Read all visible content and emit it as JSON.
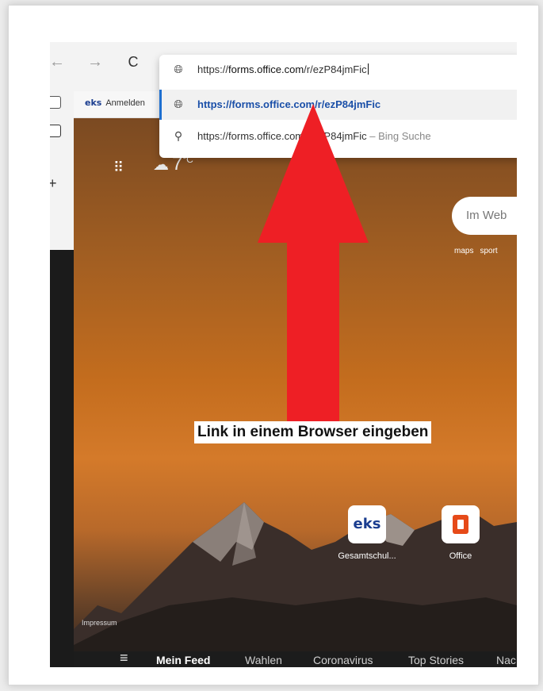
{
  "browser": {
    "nav": {
      "back_icon": "←",
      "forward_icon": "→",
      "reload_icon": "C"
    },
    "address_bar": {
      "input_prefix": "https://",
      "input_host": "forms.office.com",
      "input_path": "/r/ezP84jmFic",
      "suggestion_1": "https://forms.office.com/r/ezP84jmFic",
      "suggestion_2": "https://forms.office.com/r/ezP84jmFic",
      "suggestion_2_suffix": " – Bing Suche"
    },
    "favorites": {
      "item_logo": "eks",
      "item_label": "Anmelden"
    }
  },
  "newtab": {
    "weather": {
      "temp": "7",
      "unit": "°C"
    },
    "search_placeholder": "Im Web",
    "quick_links": [
      "maps",
      "sport"
    ],
    "tiles": [
      {
        "label": "Gesamtschul...",
        "logo": "eks"
      },
      {
        "label": "Office",
        "logo": "O"
      }
    ],
    "impressum": "Impressum",
    "feed_items": [
      "Mein Feed",
      "Wahlen",
      "Coronavirus",
      "Top Stories",
      "Nac"
    ]
  },
  "annotation": {
    "caption": "Link in einem Browser eingeben",
    "arrow_color": "#ee1f25"
  }
}
